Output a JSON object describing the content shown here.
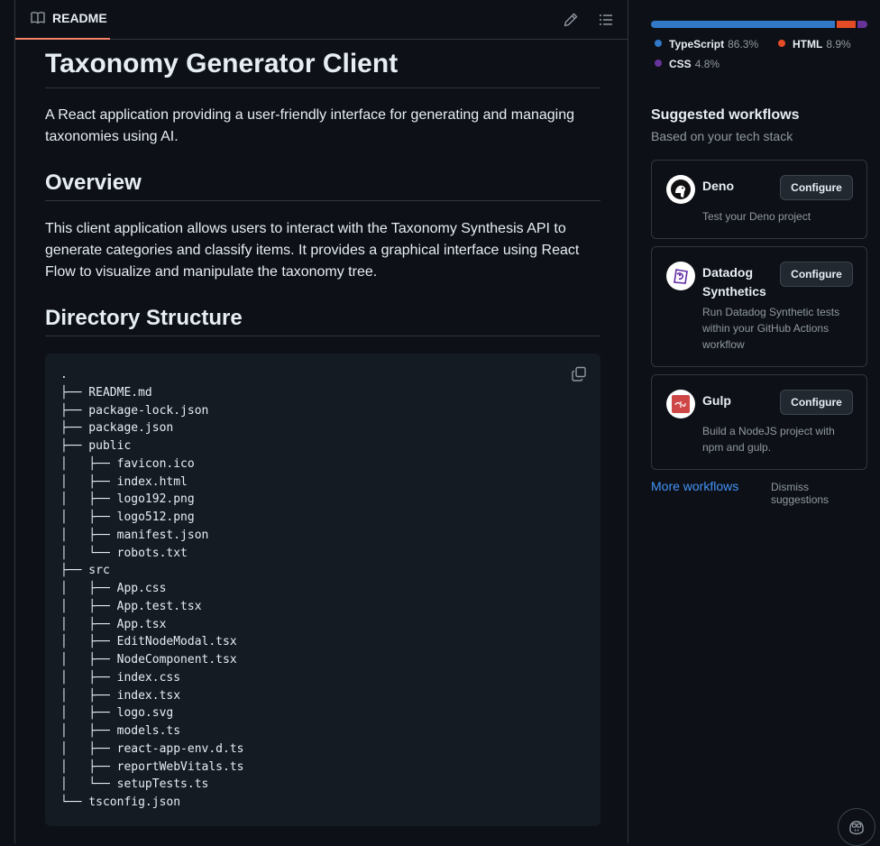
{
  "readme": {
    "tab_label": "README",
    "title": "Taxonomy Generator Client",
    "intro": "A React application providing a user-friendly interface for generating and managing taxonomies using AI.",
    "overview_heading": "Overview",
    "overview_text": "This client application allows users to interact with the Taxonomy Synthesis API to generate categories and classify items. It provides a graphical interface using React Flow to visualize and manipulate the taxonomy tree.",
    "directory_heading": "Directory Structure",
    "directory_tree": ".\n├── README.md\n├── package-lock.json\n├── package.json\n├── public\n│   ├── favicon.ico\n│   ├── index.html\n│   ├── logo192.png\n│   ├── logo512.png\n│   ├── manifest.json\n│   └── robots.txt\n├── src\n│   ├── App.css\n│   ├── App.test.tsx\n│   ├── App.tsx\n│   ├── EditNodeModal.tsx\n│   ├── NodeComponent.tsx\n│   ├── index.css\n│   ├── index.tsx\n│   ├── logo.svg\n│   ├── models.ts\n│   ├── react-app-env.d.ts\n│   ├── reportWebVitals.ts\n│   └── setupTests.ts\n└── tsconfig.json"
  },
  "languages": {
    "items": [
      {
        "name": "TypeScript",
        "percent": "86.3%",
        "value": 86.3,
        "color": "#3178c6"
      },
      {
        "name": "HTML",
        "percent": "8.9%",
        "value": 8.9,
        "color": "#e34c26"
      },
      {
        "name": "CSS",
        "percent": "4.8%",
        "value": 4.8,
        "color": "#663399"
      }
    ]
  },
  "suggested_workflows": {
    "title": "Suggested workflows",
    "subtitle": "Based on your tech stack",
    "configure_label": "Configure",
    "items": [
      {
        "name": "Deno",
        "description": "Test your Deno project",
        "icon": "deno-icon"
      },
      {
        "name": "Datadog Synthetics",
        "description": "Run Datadog Synthetic tests within your GitHub Actions workflow",
        "icon": "datadog-icon"
      },
      {
        "name": "Gulp",
        "description": "Build a NodeJS project with npm and gulp.",
        "icon": "gulp-icon"
      }
    ],
    "more_label": "More workflows",
    "dismiss_label": "Dismiss suggestions"
  }
}
